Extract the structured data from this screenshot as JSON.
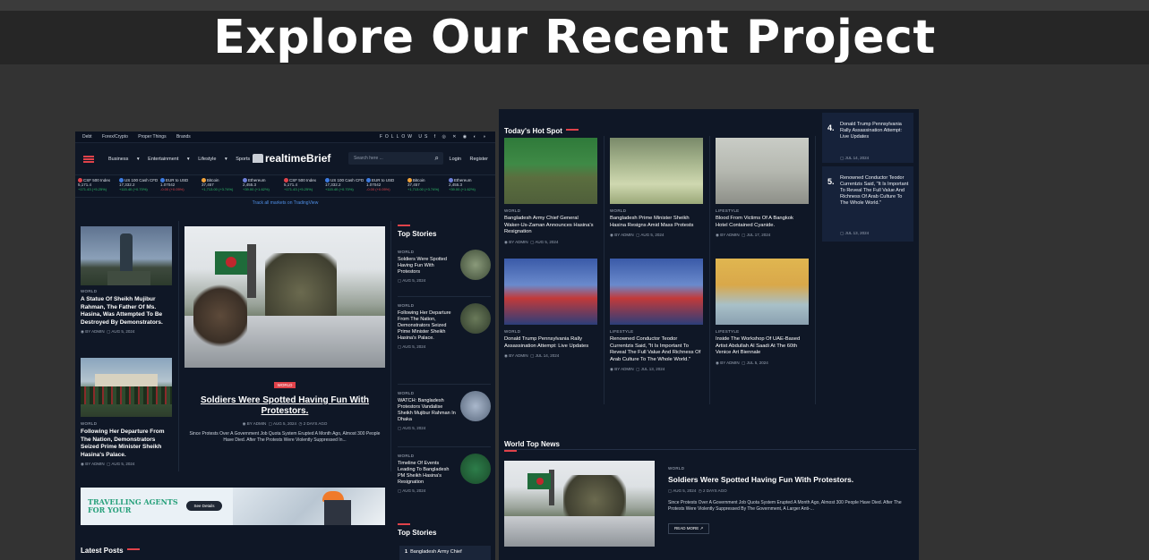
{
  "header": {
    "title": "Explore Our Recent Project"
  },
  "left_site": {
    "top_links": [
      "Debt",
      "Forex/Crypto",
      "Proper Things",
      "Brands"
    ],
    "social_label": "FOLLOW US",
    "nav": [
      "Business",
      "Entertainment",
      "Lifestyle",
      "Sports"
    ],
    "logo": "realtimeBrief",
    "search_placeholder": "Search here ...",
    "auth": [
      "Login",
      "Register"
    ],
    "ticker": [
      {
        "name": "CSF 500 Index",
        "value": "5,171.4",
        "change": "+171.43 (+5.25%)",
        "color": "#e0424a"
      },
      {
        "name": "US 100 Cash CFD",
        "value": "17,332.2",
        "change": "+115.40 (+0.70%)",
        "color": "#3d7be0"
      },
      {
        "name": "EUR to USD",
        "value": "1.07042",
        "change": "-0.00 (+0.05%)",
        "color": "#3d7be0",
        "neg": true
      },
      {
        "name": "Bitcoin",
        "value": "37,457",
        "change": "+1,713.00 (+3.74%)",
        "color": "#f2a33a"
      },
      {
        "name": "Ethereum",
        "value": "2,455.3",
        "change": "+39.00 (+1.62%)",
        "color": "#6d7fd8"
      },
      {
        "name": "CSF 500 Index",
        "value": "5,171.4",
        "change": "+171.43 (+5.25%)",
        "color": "#e0424a"
      },
      {
        "name": "US 100 Cash CFD",
        "value": "17,332.2",
        "change": "+115.40 (+0.70%)",
        "color": "#3d7be0"
      },
      {
        "name": "EUR to USD",
        "value": "1.07042",
        "change": "-0.00 (+0.05%)",
        "color": "#3d7be0",
        "neg": true
      },
      {
        "name": "Bitcoin",
        "value": "37,457",
        "change": "+1,713.00 (+3.74%)",
        "color": "#f2a33a"
      },
      {
        "name": "Ethereum",
        "value": "2,455.3",
        "change": "+39.00 (+1.62%)",
        "color": "#6d7fd8"
      }
    ],
    "ticker_link": "Track all markets on TradingView",
    "left_col": [
      {
        "cat": "WORLD",
        "title": "A Statue Of Sheikh Mujibur Rahman, The Father Of Ms. Hasina, Was Attempted To Be Destroyed By Demonstrators.",
        "author": "BY ADMIN",
        "date": "AUG 5, 2024"
      },
      {
        "cat": "WORLD",
        "title": "Following Her Departure From The Nation, Demonstrators Seized Prime Minister Sheikh Hasina's Palace.",
        "author": "BY ADMIN",
        "date": "AUG 5, 2024"
      }
    ],
    "feature": {
      "badge": "WORLD",
      "title": "Soldiers Were Spotted Having Fun With Protestors.",
      "author": "BY ADMIN",
      "date": "AUG 5, 2024",
      "ago": "2 DAYS AGO",
      "excerpt": "Since Protests Over A Government Job Quota System Erupted A Month Ago, Almost 300 People Have Died. After The Protests Were Violently Suppressed In..."
    },
    "top_stories_title": "Top Stories",
    "top_stories": [
      {
        "cat": "WORLD",
        "title": "Soldiers Were Spotted Having Fun With Protestors",
        "date": "AUG 5, 2024"
      },
      {
        "cat": "WORLD",
        "title": "Following Her Departure From The Nation, Demonstrators Seized Prime Minister Sheikh Hasina's Palace.",
        "date": "AUG 5, 2024"
      },
      {
        "cat": "WORLD",
        "title": "WATCH: Bangladesh Protestors Vandalise Sheikh Mujibur Rahman In Dhaka",
        "date": "AUG 5, 2024"
      },
      {
        "cat": "WORLD",
        "title": "Timeline Of Events Leading To Bangladesh PM Sheikh Hasina's Resignation",
        "date": "AUG 5, 2024"
      }
    ],
    "ad": {
      "line1": "TRAVELLING AGENTS",
      "line2": "FOR YOUR",
      "button": "See Details"
    },
    "latest_posts": "Latest Posts",
    "top_stories_2": "Top Stories",
    "top_stories_2_item": "Bangladesh Army Chief"
  },
  "right_site": {
    "hot_spot_title": "Today's Hot Spot",
    "hot_spot": [
      {
        "cat": "WORLD",
        "title": "Bangladesh Army Chief General Waker-Us-Zaman Announces Hasina's Resignation",
        "author": "BY ADMIN",
        "date": "AUG 5, 2024"
      },
      {
        "cat": "WORLD",
        "title": "Bangladesh Prime Minister Sheikh Hasina Resigns Amid Mass Protests",
        "author": "BY ADMIN",
        "date": "AUG 5, 2024"
      },
      {
        "cat": "LIFESTYLE",
        "title": "Blood From Victims Of A Bangkok Hotel Contained Cyanide.",
        "author": "BY ADMIN",
        "date": "JUL 17, 2024"
      },
      {
        "cat": "WORLD",
        "title": "Donald Trump Pennsylvania Rally Assassination Attempt: Live Updates",
        "author": "BY ADMIN",
        "date": "JUL 14, 2024"
      },
      {
        "cat": "LIFESTYLE",
        "title": "Renowned Conductor Teodor Currentzis Said, \"It Is Important To Reveal The Full Value And Richness Of Arab Culture To The Whole World.\"",
        "author": "BY ADMIN",
        "date": "JUL 13, 2024"
      },
      {
        "cat": "LIFESTYLE",
        "title": "Inside The Workshop Of UAE-Based Artist Abdullah Al Saadi At The 60th Venice Art Biennale",
        "author": "BY ADMIN",
        "date": "JUL 5, 2024"
      }
    ],
    "numbered": [
      {
        "num": "4.",
        "title": "Donald Trump Pennsylvania Rally Assassination Attempt: Live Updates",
        "date": "JUL 14, 2024"
      },
      {
        "num": "5.",
        "title": "Renowned Conductor Teodor Currentzis Said, \"It Is Important To Reveal The Full Value And Richness Of Arab Culture To The Whole World.\"",
        "date": "JUL 13, 2024"
      }
    ],
    "world_top_title": "World Top News",
    "world_top": {
      "cat": "WORLD",
      "title": "Soldiers Were Spotted Having Fun With Protestors.",
      "date": "AUG 5, 2024",
      "ago": "2 DAYS AGO",
      "excerpt": "Since Protests Over A Government Job Quota System Erupted A Month Ago, Almost 300 People Have Died. After The Protests Were Violently Suppressed By The Government, A Larger Anti-...",
      "read_more": "READ MORE"
    }
  }
}
